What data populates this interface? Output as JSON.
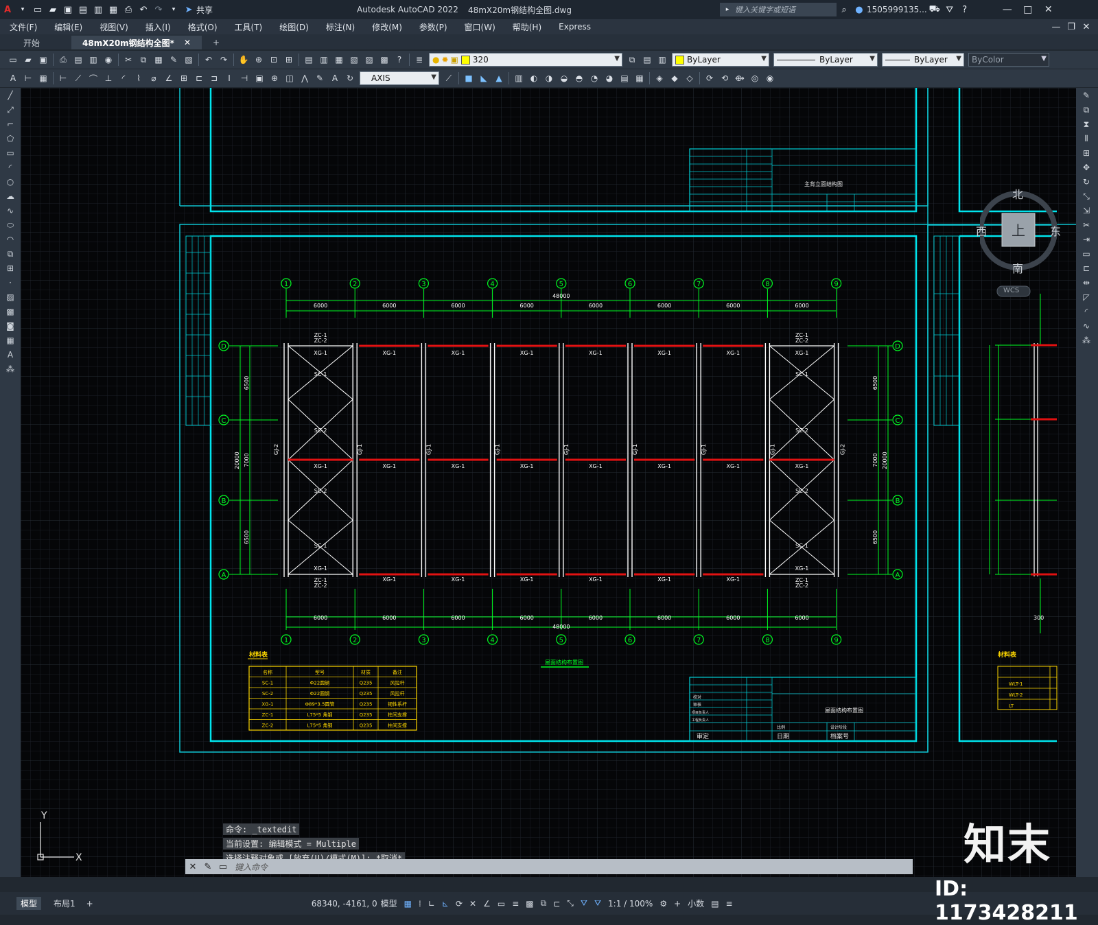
{
  "window": {
    "app_title": "Autodesk AutoCAD 2022",
    "file_title": "48mX20m钢结构全图.dwg",
    "share_label": "共享",
    "search_placeholder": "键入关键字或短语",
    "user": "1505999135...",
    "controls": [
      "—",
      "□",
      "✕"
    ]
  },
  "menu": [
    "文件(F)",
    "编辑(E)",
    "视图(V)",
    "插入(I)",
    "格式(O)",
    "工具(T)",
    "绘图(D)",
    "标注(N)",
    "修改(M)",
    "参数(P)",
    "窗口(W)",
    "帮助(H)",
    "Express"
  ],
  "tabs": {
    "start": "开始",
    "active": "48mX20m钢结构全图*",
    "add": "+"
  },
  "toolbar": {
    "layer_value": "320",
    "color": "ByLayer",
    "linetype": "ByLayer",
    "lineweight": "ByLayer",
    "plotstyle": "ByColor",
    "dimstyle": "AXIS"
  },
  "viewcube": {
    "north": "北",
    "south": "南",
    "east": "东",
    "west": "西",
    "top": "上",
    "wcs": "WCS"
  },
  "drawing": {
    "column_labels": [
      "1",
      "2",
      "3",
      "4",
      "5",
      "6",
      "7",
      "8",
      "9"
    ],
    "row_labels": [
      "D",
      "C",
      "B",
      "A"
    ],
    "span_label": "6000",
    "total_length": "48000",
    "row_dims": [
      "6500",
      "7000",
      "6500"
    ],
    "total_width": "20000",
    "beam_label": "XG-1",
    "brace_labels": [
      "SC-1",
      "SC-2",
      "SC-2",
      "SC-1"
    ],
    "column_label_end": "GJ-2",
    "column_label_mid": "GJ-1",
    "tie_top": [
      "ZC-1",
      "ZC-2"
    ],
    "plan_title": "屋面结构布置图",
    "frame_title_top": "主背立面结构图",
    "frame_title_bottom": "屋面结构布置图",
    "material_title": "材料表",
    "material_headers": [
      "名称",
      "型号",
      "材质",
      "备注"
    ],
    "material_rows": [
      [
        "SC-1",
        "Φ22圆钢",
        "Q235",
        "风拉杆"
      ],
      [
        "SC-2",
        "Φ22圆钢",
        "Q235",
        "风拉杆"
      ],
      [
        "XG-1",
        "Φ89*3.5圆管",
        "Q235",
        "钢性系杆"
      ],
      [
        "ZC-1",
        "L75*5 角钢",
        "Q235",
        "柱间支撑"
      ],
      [
        "ZC-2",
        "L75*5 角钢",
        "Q235",
        "柱间支撑"
      ]
    ],
    "tb_left_cells": [
      "校对",
      "审核",
      "项目负责人",
      "工程负责人"
    ],
    "tb_bottom": [
      "审定",
      "日期",
      "档案号",
      "比例",
      "设计阶段"
    ],
    "right_material_rows": [
      "WLT-1",
      "WLT-2",
      "LT"
    ],
    "right_dim_300": "300"
  },
  "command": {
    "history": [
      "命令: _textedit",
      "当前设置: 编辑模式 = Multiple",
      "选择注释对象或 [放弃(U)/模式(M)]: *取消*"
    ],
    "placeholder": "键入命令"
  },
  "status": {
    "tab_model": "模型",
    "tab_layout": "布局1",
    "coords": "68340, -4161, 0",
    "mode": "模型",
    "scale": "1:1 / 100%",
    "units": "小数"
  },
  "watermark": {
    "brand": "知末",
    "id": "ID: 1173428211"
  }
}
